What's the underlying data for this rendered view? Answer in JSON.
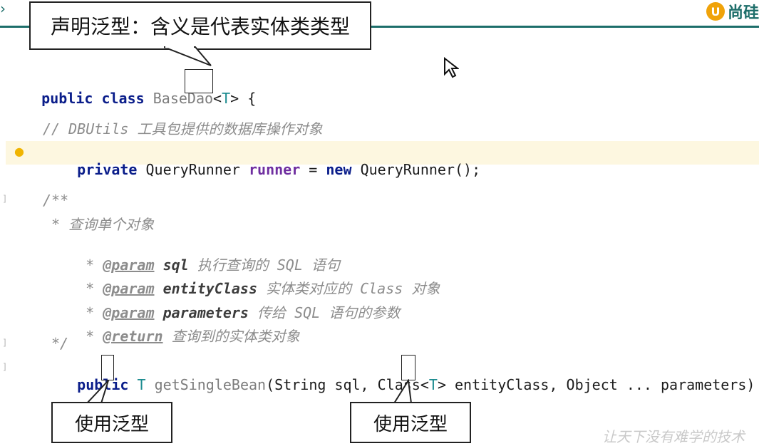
{
  "top_callout": "声明泛型：含义是代表实体类类型",
  "bottom_callouts": [
    "使用泛型",
    "使用泛型"
  ],
  "logo_text": "尚硅",
  "watermark": "让天下没有难学的技术",
  "colors": {
    "teal_rule": "#1d6e6a",
    "keyword": "#0a1d8a",
    "type_param": "#1b8b8f",
    "highlight": "#fdf7e0",
    "field": "#6f2ea0"
  },
  "code": {
    "line1": {
      "kw1": "public",
      "kw2": "class",
      "name": "BaseDao",
      "lt": "<",
      "t": "T",
      "gt": ">",
      "brace": " {"
    },
    "line2": "// DBUtils 工具包提供的数据库操作对象",
    "line3": {
      "kw": "private",
      "type": "QueryRunner",
      "field": "runner",
      "eq": " = ",
      "new": "new",
      "ctor": "QueryRunner();"
    },
    "doc": {
      "open": "/**",
      "l1": "* 查询单个对象",
      "p1": {
        "star": "* ",
        "tag": "@param",
        "name": "sql",
        "desc": " 执行查询的 SQL 语句"
      },
      "p2": {
        "star": "* ",
        "tag": "@param",
        "name": "entityClass",
        "desc": " 实体类对应的 Class 对象"
      },
      "p3": {
        "star": "* ",
        "tag": "@param",
        "name": "parameters",
        "desc": " 传给 SQL 语句的参数"
      },
      "ret": {
        "star": "* ",
        "tag": "@return",
        "desc": " 查询到的实体类对象"
      },
      "close": "*/"
    },
    "method": {
      "kw": "public",
      "t": "T",
      "name": "getSingleBean",
      "args1": "(String sql, Class<",
      "t2": "T",
      "args2": "> entityClass, Object ... parameters) {"
    }
  }
}
